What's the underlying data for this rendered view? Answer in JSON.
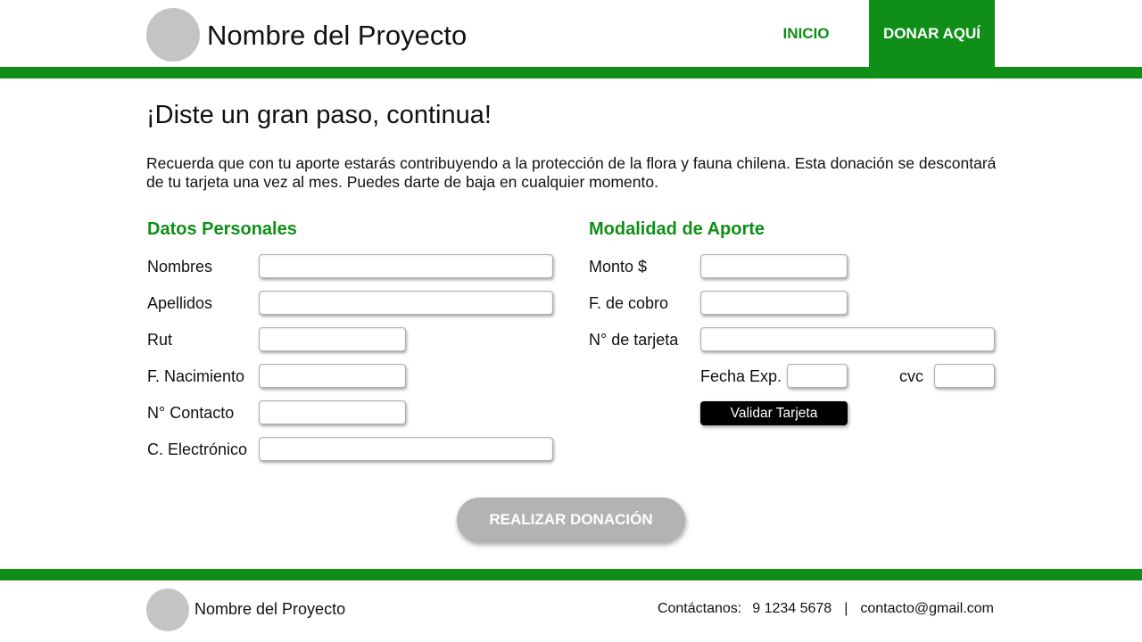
{
  "header": {
    "brand": "Nombre del Proyecto",
    "nav_home": "INICIO",
    "nav_donate": "DONAR AQUÍ"
  },
  "main": {
    "title": "¡Diste un gran paso, continua!",
    "intro": "Recuerda que con tu aporte estarás contribuyendo a la protección de la flora y fauna chilena. Esta donación se descontará de tu tarjeta una vez al mes. Puedes darte de baja en cualquier momento."
  },
  "personal": {
    "heading": "Datos Personales",
    "fields": {
      "nombres": {
        "label": "Nombres",
        "value": ""
      },
      "apellidos": {
        "label": "Apellidos",
        "value": ""
      },
      "rut": {
        "label": "Rut",
        "value": ""
      },
      "nacimiento": {
        "label": "F. Nacimiento",
        "value": ""
      },
      "contacto": {
        "label": "N° Contacto",
        "value": ""
      },
      "email": {
        "label": "C. Electrónico",
        "value": ""
      }
    }
  },
  "payment": {
    "heading": "Modalidad de Aporte",
    "fields": {
      "monto": {
        "label": "Monto $",
        "value": ""
      },
      "cobro": {
        "label": "F. de cobro",
        "value": ""
      },
      "tarjeta": {
        "label": "N° de tarjeta",
        "value": ""
      },
      "exp": {
        "label": "Fecha Exp.",
        "value": ""
      },
      "cvc": {
        "label": "cvc",
        "value": ""
      }
    },
    "validate_label": "Validar Tarjeta"
  },
  "donate_label": "REALIZAR DONACIÓN",
  "footer": {
    "brand": "Nombre del Proyecto",
    "contact_label": "Contáctanos:",
    "phone": "9 1234 5678",
    "separator": "|",
    "email": "contacto@gmail.com"
  },
  "colors": {
    "brand_green": "#0f8f17",
    "logo_gray": "#c4c4c4",
    "button_disabled": "#b3b3b3"
  }
}
